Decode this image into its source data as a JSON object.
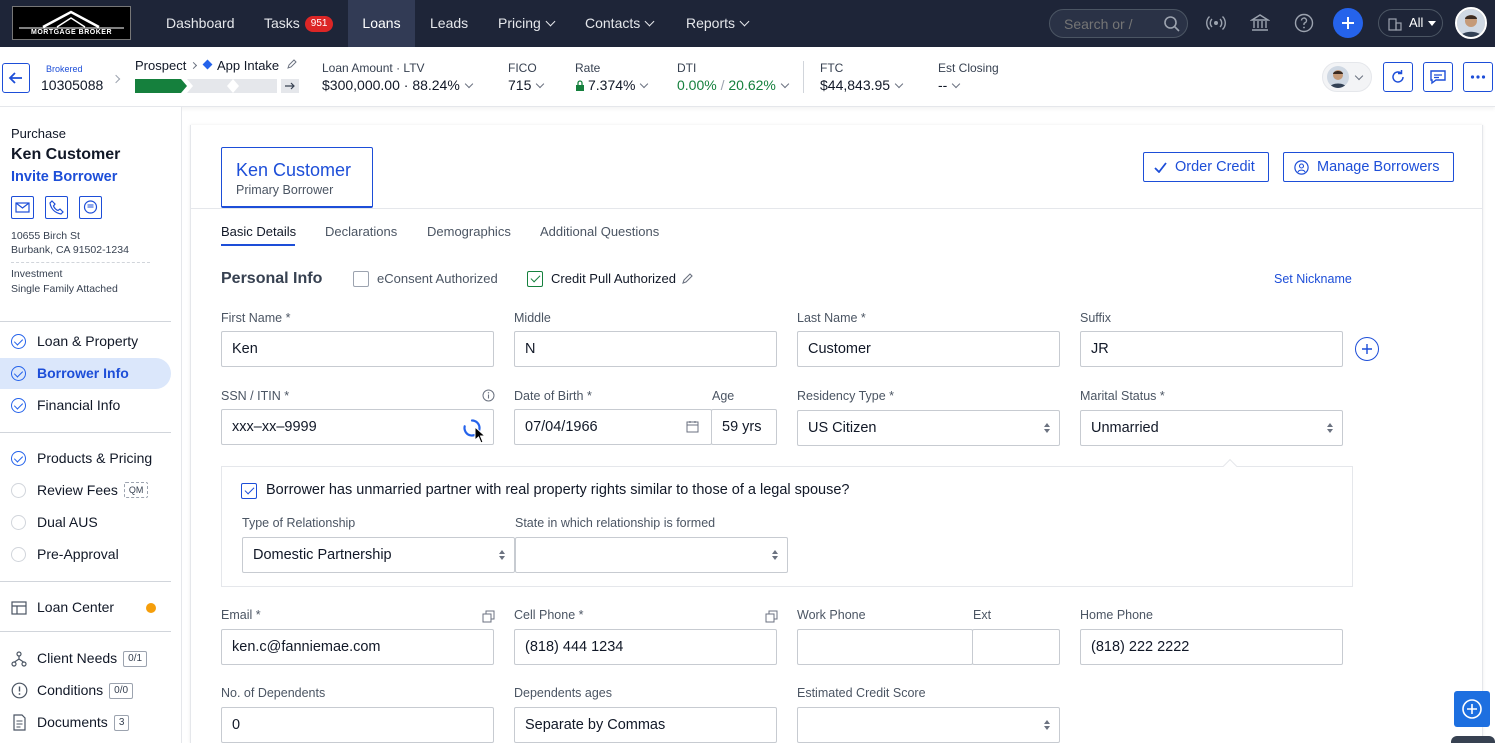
{
  "topnav": {
    "logo_text": "MORTGAGE BROKER",
    "items": [
      {
        "label": "Dashboard"
      },
      {
        "label": "Tasks",
        "badge": "951"
      },
      {
        "label": "Loans"
      },
      {
        "label": "Leads"
      },
      {
        "label": "Pricing"
      },
      {
        "label": "Contacts"
      },
      {
        "label": "Reports"
      }
    ],
    "search_placeholder": "Search or /",
    "scope": "All"
  },
  "loanbar": {
    "channel": "Brokered",
    "loan_number": "10305088",
    "stage": "Prospect",
    "substage": "App Intake",
    "loan_amount_label": "Loan Amount",
    "ltv_label": "LTV",
    "loan_amount": "$300,000.00",
    "ltv": "88.24%",
    "fico_label": "FICO",
    "fico": "715",
    "rate_label": "Rate",
    "rate": "7.374%",
    "dti_label": "DTI",
    "dti_front": "0.00%",
    "dti_back": "20.62%",
    "ftc_label": "FTC",
    "ftc": "$44,843.95",
    "est_closing_label": "Est Closing",
    "est_closing": "--",
    "progress_fraction": 0.37
  },
  "sidebar": {
    "loan_purpose": "Purchase",
    "borrower_name": "Ken Customer",
    "invite": "Invite Borrower",
    "address_line1": "10655 Birch St",
    "address_line2": "Burbank, CA 91502-1234",
    "occupancy": "Investment",
    "property_type": "Single Family Attached",
    "steps": [
      {
        "label": "Loan & Property",
        "state": "done"
      },
      {
        "label": "Borrower Info",
        "state": "done"
      },
      {
        "label": "Financial Info",
        "state": "done"
      },
      {
        "label": "Products & Pricing",
        "state": "done"
      },
      {
        "label": "Review Fees",
        "state": "todo",
        "tag": "QM"
      },
      {
        "label": "Dual AUS",
        "state": "todo"
      },
      {
        "label": "Pre-Approval",
        "state": "todo"
      }
    ],
    "loan_center": "Loan Center",
    "client_needs": "Client Needs",
    "client_needs_count": "0/1",
    "conditions": "Conditions",
    "conditions_count": "0/0",
    "documents": "Documents",
    "documents_count": "3"
  },
  "main": {
    "borrower_card_name": "Ken Customer",
    "borrower_card_role": "Primary Borrower",
    "order_credit": "Order Credit",
    "manage_borrowers": "Manage Borrowers",
    "tabs": [
      "Basic Details",
      "Declarations",
      "Demographics",
      "Additional Questions"
    ],
    "section_title": "Personal Info",
    "econsent_label": "eConsent Authorized",
    "credit_pull_label": "Credit Pull Authorized",
    "set_nickname": "Set Nickname",
    "first_name_label": "First Name *",
    "first_name": "Ken",
    "middle_label": "Middle",
    "middle": "N",
    "last_name_label": "Last Name *",
    "last_name": "Customer",
    "suffix_label": "Suffix",
    "suffix": "JR",
    "ssn_label": "SSN / ITIN *",
    "ssn": "xxx–xx–9999",
    "dob_label": "Date of Birth *",
    "dob": "07/04/1966",
    "age_label": "Age",
    "age": "59 yrs",
    "residency_label": "Residency Type *",
    "residency": "US Citizen",
    "marital_label": "Marital Status *",
    "marital": "Unmarried",
    "partner_question": "Borrower has unmarried partner with real property rights similar to those of a legal spouse?",
    "relationship_type_label": "Type of Relationship",
    "relationship_type": "Domestic Partnership",
    "relationship_state_label": "State in which relationship is formed",
    "relationship_state": "",
    "email_label": "Email *",
    "email": "ken.c@fanniemae.com",
    "cell_label": "Cell Phone *",
    "cell": "(818) 444 1234",
    "work_label": "Work Phone",
    "work": "",
    "ext_label": "Ext",
    "ext": "",
    "home_label": "Home Phone",
    "home": "(818) 222 2222",
    "dependents_label": "No. of Dependents",
    "dependents": "0",
    "dependents_ages_label": "Dependents ages",
    "dependents_ages_placeholder": "Separate by Commas",
    "credit_score_label": "Estimated Credit Score",
    "credit_score": ""
  },
  "colors": {
    "nav_bg": "#1e2538",
    "accent": "#1d4ed8",
    "success": "#15803d",
    "badge": "#dc2626"
  }
}
